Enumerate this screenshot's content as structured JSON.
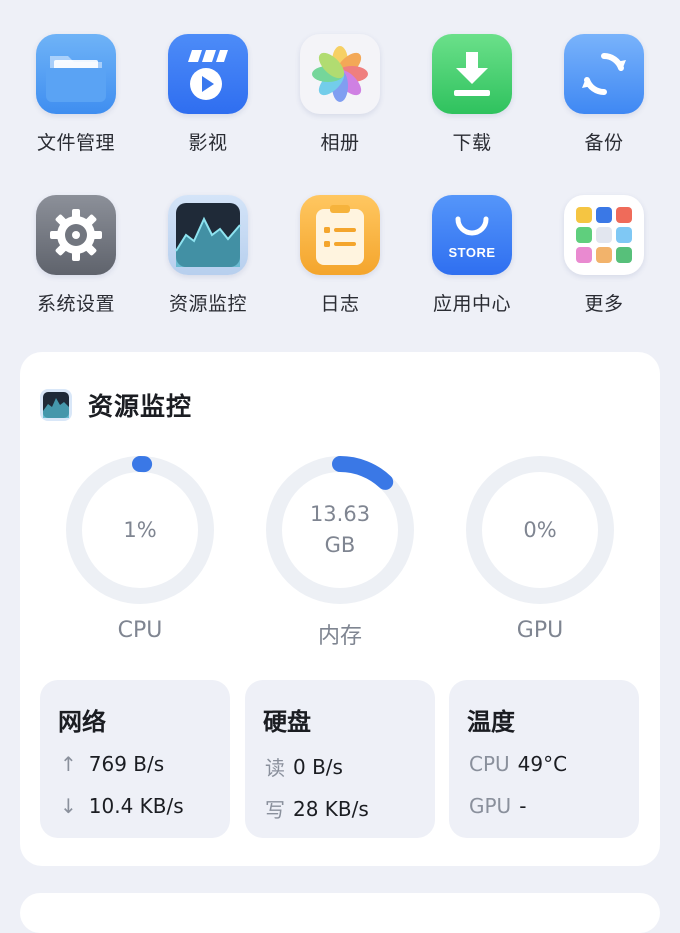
{
  "apps": [
    {
      "label": "文件管理",
      "icon": "folder-icon"
    },
    {
      "label": "影视",
      "icon": "video-player-icon"
    },
    {
      "label": "相册",
      "icon": "photos-icon"
    },
    {
      "label": "下载",
      "icon": "download-icon"
    },
    {
      "label": "备份",
      "icon": "backup-sync-icon"
    },
    {
      "label": "系统设置",
      "icon": "gear-icon"
    },
    {
      "label": "资源监控",
      "icon": "resource-chart-icon"
    },
    {
      "label": "日志",
      "icon": "log-notepad-icon"
    },
    {
      "label": "应用中心",
      "icon": "store-bag-icon",
      "badge": "STORE"
    },
    {
      "label": "更多",
      "icon": "app-grid-icon"
    }
  ],
  "monitor": {
    "title": "资源监控",
    "gauges": [
      {
        "label": "CPU",
        "value": "1%",
        "unit": "",
        "fraction": 0.01
      },
      {
        "label": "内存",
        "value": "13.63",
        "unit": "GB",
        "fraction": 0.12
      },
      {
        "label": "GPU",
        "value": "0%",
        "unit": "",
        "fraction": 0
      }
    ],
    "network": {
      "title": "网络",
      "up": "769 B/s",
      "down": "10.4 KB/s"
    },
    "disk": {
      "title": "硬盘",
      "read_label": "读",
      "read": "0 B/s",
      "write_label": "写",
      "write": "28 KB/s"
    },
    "temperature": {
      "title": "温度",
      "cpu_label": "CPU",
      "cpu": "49°C",
      "gpu_label": "GPU",
      "gpu": "-"
    }
  },
  "colors": {
    "accent": "#3a78e6",
    "track": "#edf0f5",
    "background": "#eef0f7"
  }
}
